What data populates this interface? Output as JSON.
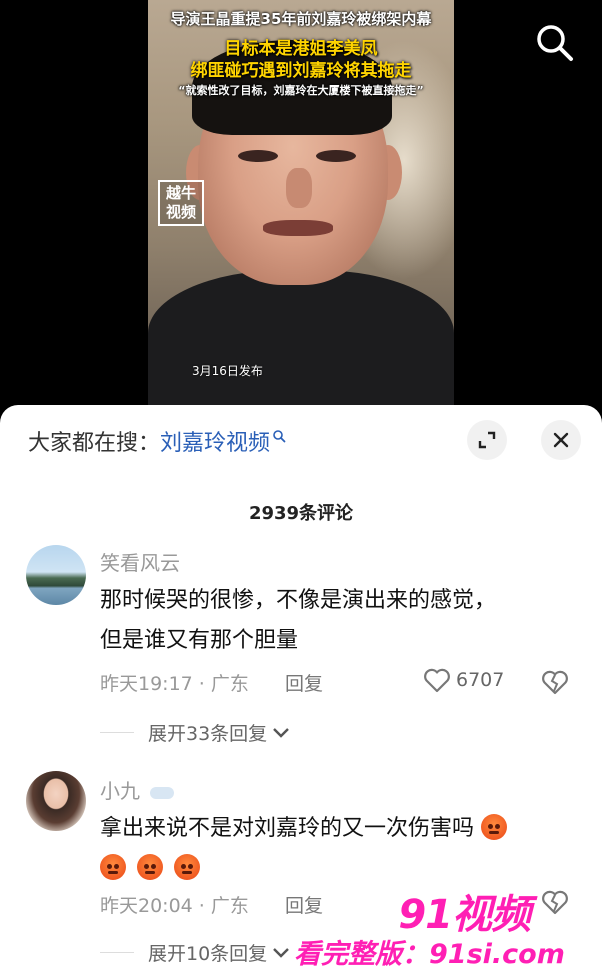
{
  "video": {
    "caption_lines": [
      "导演王晶重提35年前刘嘉玲被绑架内幕",
      "目标本是港姐李美凤",
      "绑匪碰巧遇到刘嘉玲将其拖走",
      "“就索性改了目标，刘嘉玲在大厦楼下被直接拖走”"
    ],
    "channel_badge": "越牛\n视频",
    "publish_date": "3月16日发布"
  },
  "search_bar": {
    "label": "大家都在搜：",
    "term": "刘嘉玲视频"
  },
  "comments_header": {
    "count_text": "2939条评论"
  },
  "comments": [
    {
      "username": "笑看风云",
      "text_lines": [
        "那时候哭的很惨，不像是演出来的感觉，",
        "但是谁又有那个胆量"
      ],
      "time": "昨天19:17 · 广东",
      "reply_label": "回复",
      "likes": "6707",
      "expand_label": "展开33条回复"
    },
    {
      "username": "小九",
      "text_lines": [
        "拿出来说不是对刘嘉玲的又一次伤害吗"
      ],
      "emoji_icons": [
        "angry-face-icon",
        "angry-face-icon",
        "angry-face-icon",
        "angry-face-icon"
      ],
      "time": "昨天20:04 · 广东",
      "reply_label": "回复",
      "expand_label": "展开10条回复"
    }
  ],
  "watermark": {
    "logo": "91视频",
    "url": "看完整版：91si.com"
  },
  "colors": {
    "search_term": "#2a5fb7",
    "watermark": "#ff1fb4",
    "caption_highlight": "#ffd400"
  }
}
